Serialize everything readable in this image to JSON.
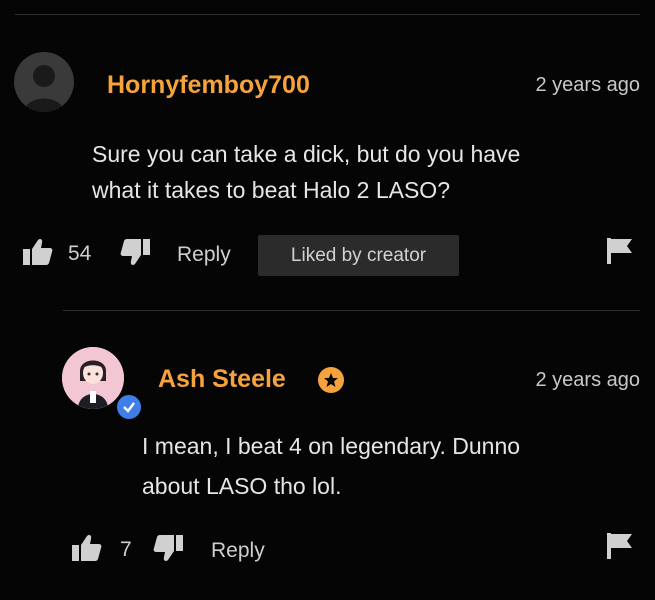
{
  "comments": [
    {
      "username": "Hornyfemboy700",
      "timestamp": "2 years ago",
      "text_line1": "Sure you can take a dick, but do you have",
      "text_line2": "what it takes to beat Halo 2 LASO?",
      "likes": "54",
      "reply_label": "Reply",
      "badge": "Liked by creator"
    },
    {
      "username": "Ash Steele",
      "timestamp": "2 years ago",
      "text_line1": "I mean, I beat 4 on legendary. Dunno",
      "text_line2": "about LASO tho lol.",
      "likes": "7",
      "reply_label": "Reply"
    }
  ],
  "icons": {
    "generic_avatar": "user-silhouette-icon",
    "thumbs_up": "thumbs-up-icon",
    "thumbs_down": "thumbs-down-icon",
    "flag": "flag-icon",
    "star": "star-badge-icon",
    "verified": "verified-check-icon"
  },
  "colors": {
    "username": "#f7a33d",
    "background": "#050505",
    "verified": "#3e7ee8"
  }
}
